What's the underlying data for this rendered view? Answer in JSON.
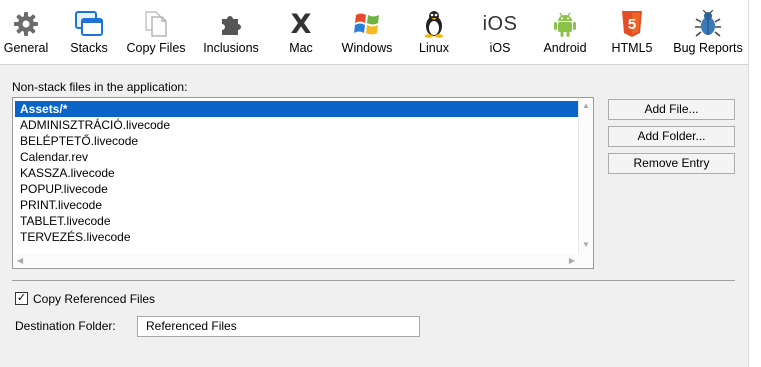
{
  "tabs": [
    {
      "label": "General",
      "icon": "gear-icon",
      "active": false
    },
    {
      "label": "Stacks",
      "icon": "stacks-icon",
      "active": false
    },
    {
      "label": "Copy Files",
      "icon": "copy-files-icon",
      "active": true
    },
    {
      "label": "Inclusions",
      "icon": "puzzle-icon",
      "active": false
    },
    {
      "label": "Mac",
      "icon": "mac-x-icon",
      "active": false,
      "glyph": "X"
    },
    {
      "label": "Windows",
      "icon": "windows-icon",
      "active": false
    },
    {
      "label": "Linux",
      "icon": "linux-tux-icon",
      "active": false
    },
    {
      "label": "iOS",
      "icon": "ios-icon",
      "active": false,
      "glyph": "iOS"
    },
    {
      "label": "Android",
      "icon": "android-icon",
      "active": false
    },
    {
      "label": "HTML5",
      "icon": "html5-icon",
      "active": false,
      "glyph": "5"
    },
    {
      "label": "Bug Reports",
      "icon": "bug-icon",
      "active": false
    }
  ],
  "files_section": {
    "label": "Non-stack files in the application:",
    "files": [
      "Assets/*",
      "ADMINISZTRÁCIÓ.livecode",
      "BELÉPTETŐ.livecode",
      "Calendar.rev",
      "KASSZA.livecode",
      "POPUP.livecode",
      "PRINT.livecode",
      "TABLET.livecode",
      "TERVEZÉS.livecode"
    ],
    "selected_index": 0
  },
  "buttons": {
    "add_file": "Add File...",
    "add_folder": "Add Folder...",
    "remove_entry": "Remove Entry"
  },
  "copy_referenced": {
    "label": "Copy Referenced Files",
    "checked": true,
    "check_glyph": "✓"
  },
  "destination": {
    "label": "Destination Folder:",
    "value": "Referenced Files"
  },
  "scroll_arrows": {
    "up": "▲",
    "down": "▼",
    "left": "◀",
    "right": "▶"
  },
  "colors": {
    "selection": "#0a64c8",
    "panel": "#f0f0f0"
  }
}
